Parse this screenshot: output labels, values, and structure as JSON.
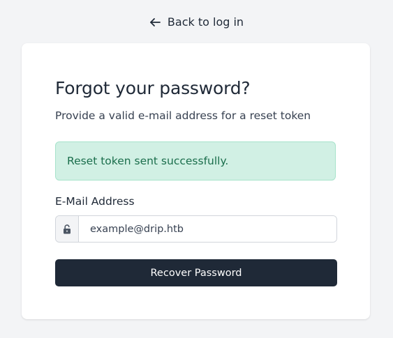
{
  "header": {
    "back_link_label": "Back to log in",
    "back_icon": "arrow-left-icon"
  },
  "form": {
    "title": "Forgot your password?",
    "subtitle": "Provide a valid e-mail address for a reset token",
    "alert": {
      "message": "Reset token sent successfully.",
      "status": "success",
      "background_color": "#d1f0e4",
      "text_color": "#1b6e4c"
    },
    "email": {
      "label": "E-Mail Address",
      "placeholder": "example@drip.htb",
      "value": "",
      "icon": "unlock-icon"
    },
    "submit_label": "Recover Password"
  },
  "colors": {
    "background": "#f3f4f6",
    "card": "#ffffff",
    "primary_button": "#1f2937"
  }
}
